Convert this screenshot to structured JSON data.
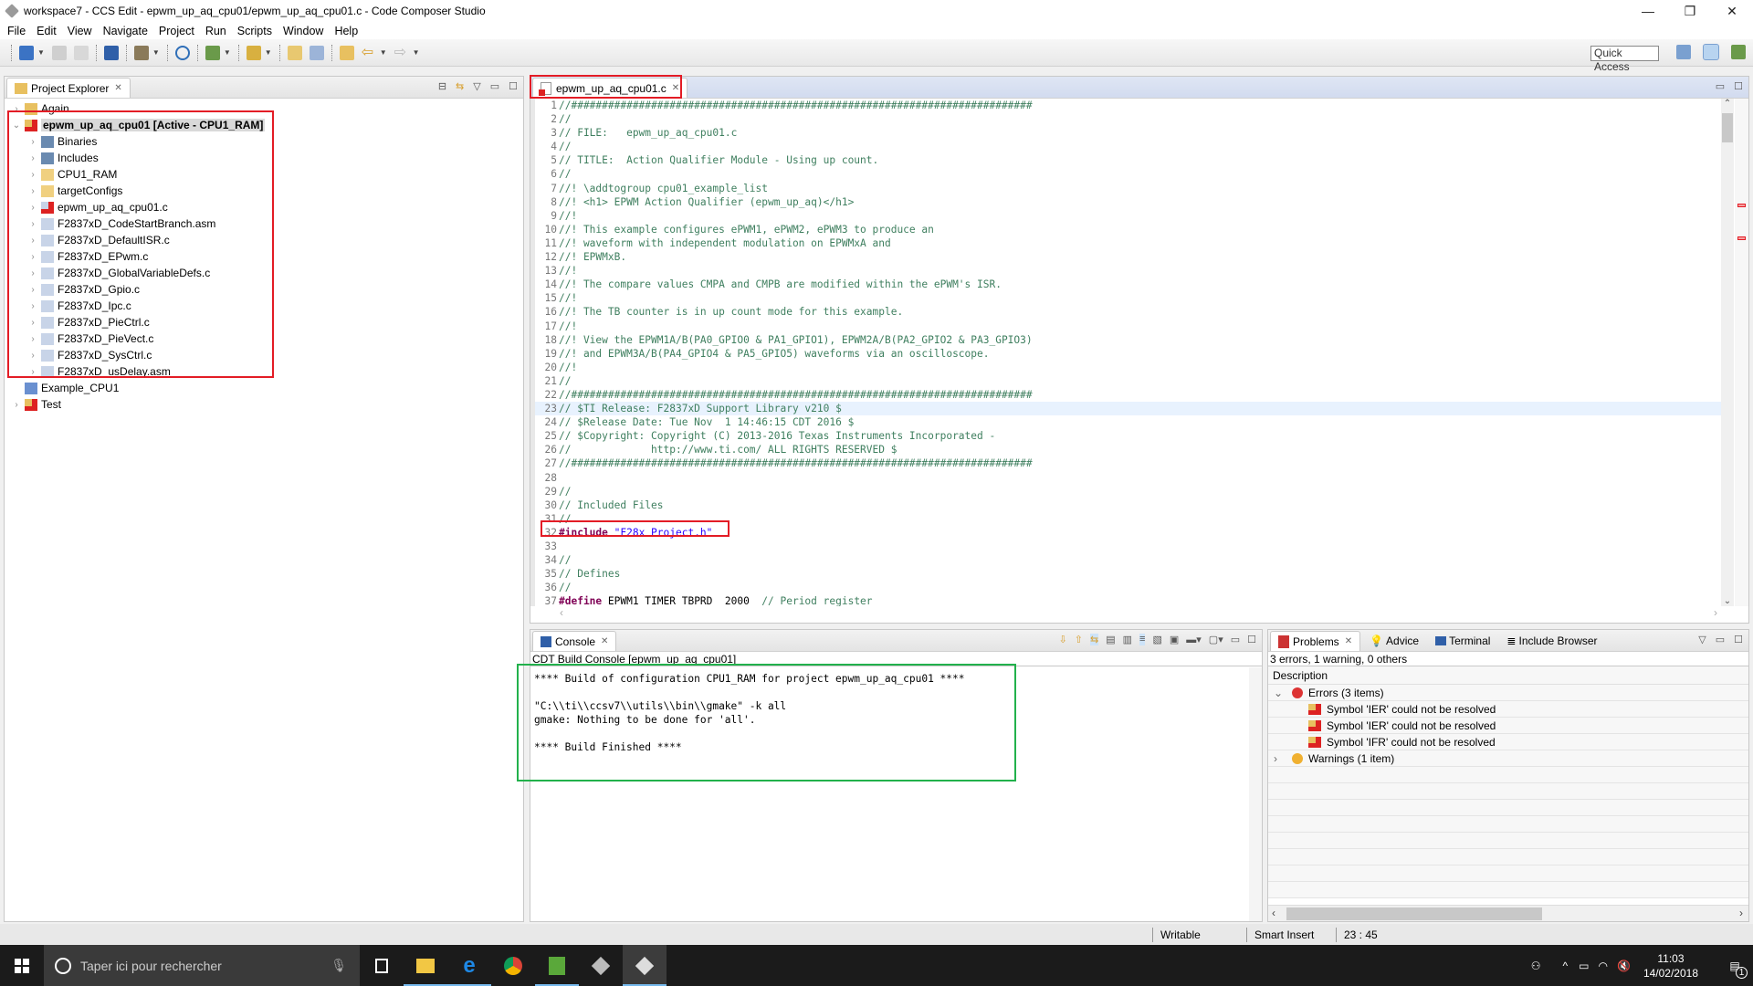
{
  "window": {
    "title": "workspace7 - CCS Edit - epwm_up_aq_cpu01/epwm_up_aq_cpu01.c - Code Composer Studio",
    "minimize": "—",
    "maximize": "❐",
    "close": "✕"
  },
  "menu": [
    "File",
    "Edit",
    "View",
    "Navigate",
    "Project",
    "Run",
    "Scripts",
    "Window",
    "Help"
  ],
  "toolbar": {
    "quick_access": "Quick Access"
  },
  "project_explorer": {
    "title": "Project Explorer",
    "items": [
      {
        "label": "Again",
        "level": 0,
        "twisty": "›",
        "icon": "ccs-project-icon",
        "bold": false
      },
      {
        "label": "epwm_up_aq_cpu01  [Active - CPU1_RAM]",
        "level": 0,
        "twisty": "⌄",
        "icon": "ccs-project-error-icon",
        "bold": true,
        "selected": true
      },
      {
        "label": "Binaries",
        "level": 1,
        "twisty": "›",
        "icon": "binaries-icon"
      },
      {
        "label": "Includes",
        "level": 1,
        "twisty": "›",
        "icon": "includes-icon"
      },
      {
        "label": "CPU1_RAM",
        "level": 1,
        "twisty": "›",
        "icon": "folder-icon"
      },
      {
        "label": "targetConfigs",
        "level": 1,
        "twisty": "›",
        "icon": "folder-icon"
      },
      {
        "label": "epwm_up_aq_cpu01.c",
        "level": 1,
        "twisty": "›",
        "icon": "c-file-error-icon"
      },
      {
        "label": "F2837xD_CodeStartBranch.asm",
        "level": 1,
        "twisty": "›",
        "icon": "asm-file-link-icon"
      },
      {
        "label": "F2837xD_DefaultISR.c",
        "level": 1,
        "twisty": "›",
        "icon": "c-file-link-icon"
      },
      {
        "label": "F2837xD_EPwm.c",
        "level": 1,
        "twisty": "›",
        "icon": "c-file-link-icon"
      },
      {
        "label": "F2837xD_GlobalVariableDefs.c",
        "level": 1,
        "twisty": "›",
        "icon": "c-file-link-icon"
      },
      {
        "label": "F2837xD_Gpio.c",
        "level": 1,
        "twisty": "›",
        "icon": "c-file-link-icon"
      },
      {
        "label": "F2837xD_Ipc.c",
        "level": 1,
        "twisty": "›",
        "icon": "c-file-link-icon"
      },
      {
        "label": "F2837xD_PieCtrl.c",
        "level": 1,
        "twisty": "›",
        "icon": "c-file-link-icon"
      },
      {
        "label": "F2837xD_PieVect.c",
        "level": 1,
        "twisty": "›",
        "icon": "c-file-link-icon"
      },
      {
        "label": "F2837xD_SysCtrl.c",
        "level": 1,
        "twisty": "›",
        "icon": "c-file-link-icon"
      },
      {
        "label": "F2837xD_usDelay.asm",
        "level": 1,
        "twisty": "›",
        "icon": "asm-file-link-icon"
      },
      {
        "label": "Example_CPU1",
        "level": 0,
        "twisty": "",
        "icon": "closed-project-icon"
      },
      {
        "label": "Test",
        "level": 0,
        "twisty": "›",
        "icon": "ccs-project-error-icon"
      }
    ]
  },
  "editor": {
    "tab_label": "epwm_up_aq_cpu01.c",
    "highlight_line": 23,
    "lines": [
      {
        "n": "1",
        "parts": [
          {
            "t": "cm",
            "s": "//###########################################################################"
          }
        ]
      },
      {
        "n": "2",
        "parts": [
          {
            "t": "cm",
            "s": "//"
          }
        ]
      },
      {
        "n": "3",
        "parts": [
          {
            "t": "cm",
            "s": "// FILE:   epwm_up_aq_cpu01.c"
          }
        ]
      },
      {
        "n": "4",
        "parts": [
          {
            "t": "cm",
            "s": "//"
          }
        ]
      },
      {
        "n": "5",
        "parts": [
          {
            "t": "cm",
            "s": "// TITLE:  Action Qualifier Module - Using up count."
          }
        ]
      },
      {
        "n": "6",
        "parts": [
          {
            "t": "cm",
            "s": "//"
          }
        ]
      },
      {
        "n": "7",
        "parts": [
          {
            "t": "cm",
            "s": "//! \\addtogroup cpu01_example_list"
          }
        ]
      },
      {
        "n": "8",
        "parts": [
          {
            "t": "cm",
            "s": "//! <h1> EPWM Action Qualifier (epwm_up_aq)</h1>"
          }
        ]
      },
      {
        "n": "9",
        "parts": [
          {
            "t": "cm",
            "s": "//!"
          }
        ]
      },
      {
        "n": "10",
        "parts": [
          {
            "t": "cm",
            "s": "//! This example configures ePWM1, ePWM2, ePWM3 to produce an"
          }
        ]
      },
      {
        "n": "11",
        "parts": [
          {
            "t": "cm",
            "s": "//! waveform with independent modulation on EPWMxA and"
          }
        ]
      },
      {
        "n": "12",
        "parts": [
          {
            "t": "cm",
            "s": "//! EPWMxB."
          }
        ]
      },
      {
        "n": "13",
        "parts": [
          {
            "t": "cm",
            "s": "//!"
          }
        ]
      },
      {
        "n": "14",
        "parts": [
          {
            "t": "cm",
            "s": "//! The compare values CMPA and CMPB are modified within the ePWM's ISR."
          }
        ]
      },
      {
        "n": "15",
        "parts": [
          {
            "t": "cm",
            "s": "//!"
          }
        ]
      },
      {
        "n": "16",
        "parts": [
          {
            "t": "cm",
            "s": "//! The TB counter is in up count mode for this example."
          }
        ]
      },
      {
        "n": "17",
        "parts": [
          {
            "t": "cm",
            "s": "//!"
          }
        ]
      },
      {
        "n": "18",
        "parts": [
          {
            "t": "cm",
            "s": "//! View the EPWM1A/B(PA0_GPIO0 & PA1_GPIO1), EPWM2A/B(PA2_GPIO2 & PA3_GPIO3)"
          }
        ]
      },
      {
        "n": "19",
        "parts": [
          {
            "t": "cm",
            "s": "//! and EPWM3A/B(PA4_GPIO4 & PA5_GPIO5) waveforms via an oscilloscope."
          }
        ]
      },
      {
        "n": "20",
        "parts": [
          {
            "t": "cm",
            "s": "//!"
          }
        ]
      },
      {
        "n": "21",
        "parts": [
          {
            "t": "cm",
            "s": "//"
          }
        ]
      },
      {
        "n": "22",
        "parts": [
          {
            "t": "cm",
            "s": "//###########################################################################"
          }
        ]
      },
      {
        "n": "23",
        "parts": [
          {
            "t": "cm",
            "s": "// $TI Release: F2837xD Support Library v210 $"
          }
        ]
      },
      {
        "n": "24",
        "parts": [
          {
            "t": "cm",
            "s": "// $Release Date: Tue Nov  1 14:46:15 CDT 2016 $"
          }
        ]
      },
      {
        "n": "25",
        "parts": [
          {
            "t": "cm",
            "s": "// $Copyright: Copyright (C) 2013-2016 Texas Instruments Incorporated -"
          }
        ]
      },
      {
        "n": "26",
        "parts": [
          {
            "t": "cm",
            "s": "//             http://www.ti.com/ ALL RIGHTS RESERVED $"
          }
        ]
      },
      {
        "n": "27",
        "parts": [
          {
            "t": "cm",
            "s": "//###########################################################################"
          }
        ]
      },
      {
        "n": "28",
        "parts": []
      },
      {
        "n": "29",
        "parts": [
          {
            "t": "cm",
            "s": "//"
          }
        ]
      },
      {
        "n": "30",
        "parts": [
          {
            "t": "cm",
            "s": "// Included Files"
          }
        ]
      },
      {
        "n": "31",
        "parts": [
          {
            "t": "cm",
            "s": "//"
          }
        ]
      },
      {
        "n": "32",
        "parts": [
          {
            "t": "pp",
            "s": "#include"
          },
          {
            "t": "plain",
            "s": " "
          },
          {
            "t": "str",
            "s": "\"F28x Project.h\""
          }
        ]
      },
      {
        "n": "33",
        "parts": []
      },
      {
        "n": "34",
        "parts": [
          {
            "t": "cm",
            "s": "//"
          }
        ]
      },
      {
        "n": "35",
        "parts": [
          {
            "t": "cm",
            "s": "// Defines"
          }
        ]
      },
      {
        "n": "36",
        "parts": [
          {
            "t": "cm",
            "s": "//"
          }
        ]
      },
      {
        "n": "37",
        "parts": [
          {
            "t": "pp",
            "s": "#define"
          },
          {
            "t": "plain",
            "s": " EPWM1_TIMER_TBPRD  2000  "
          },
          {
            "t": "cm",
            "s": "// Period register"
          }
        ]
      }
    ]
  },
  "console": {
    "tab_label": "Console",
    "subtitle": "CDT Build Console [epwm_up_aq_cpu01]",
    "output": "**** Build of configuration CPU1_RAM for project epwm_up_aq_cpu01 ****\n\n\"C:\\\\ti\\\\ccsv7\\\\utils\\\\bin\\\\gmake\" -k all\ngmake: Nothing to be done for 'all'.\n\n**** Build Finished ****"
  },
  "problems": {
    "tabs": [
      "Problems",
      "Advice",
      "Terminal",
      "Include Browser"
    ],
    "summary": "3 errors, 1 warning, 0 others",
    "column": "Description",
    "groups": [
      {
        "label": "Errors (3 items)",
        "expanded": true,
        "items": [
          "Symbol 'IER' could not be resolved",
          "Symbol 'IER' could not be resolved",
          "Symbol 'IFR' could not be resolved"
        ]
      },
      {
        "label": "Warnings (1 item)",
        "expanded": false,
        "items": []
      }
    ]
  },
  "statusbar": {
    "mode": "Writable",
    "insert": "Smart Insert",
    "position": "23 : 45"
  },
  "taskbar": {
    "search_placeholder": "Taper ici pour rechercher",
    "time": "11:03",
    "date": "14/02/2018",
    "notifications": "1"
  },
  "colors": {
    "annotation_red": "#e31c25",
    "annotation_green": "#22b14c",
    "comment": "#3f7f5f",
    "keyword": "#7f0055",
    "string": "#2a00ff"
  }
}
